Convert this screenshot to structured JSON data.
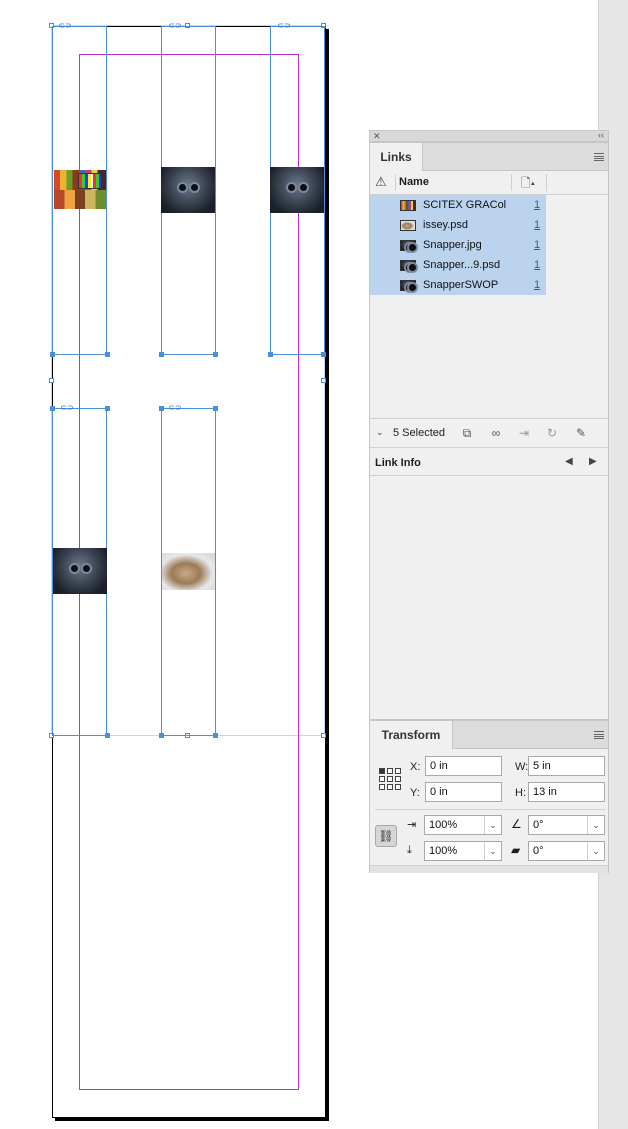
{
  "links_panel": {
    "tab_label": "Links",
    "column_name": "Name",
    "items": [
      {
        "name": "SCITEX GRACol",
        "page": "1",
        "thumb": "color-chart"
      },
      {
        "name": "issey.psd",
        "page": "1",
        "thumb": "cat"
      },
      {
        "name": "Snapper.jpg",
        "page": "1",
        "thumb": "snapper"
      },
      {
        "name": "Snapper...9.psd",
        "page": "1",
        "thumb": "snapper"
      },
      {
        "name": "SnapperSWOP",
        "page": "1",
        "thumb": "snapper"
      }
    ],
    "selected_count": "5 Selected",
    "link_info_label": "Link Info"
  },
  "transform_panel": {
    "tab_label": "Transform",
    "x_label": "X:",
    "x_value": "0 in",
    "y_label": "Y:",
    "y_value": "0 in",
    "w_label": "W:",
    "w_value": "5 in",
    "h_label": "H:",
    "h_value": "13 in",
    "scale_x": "100%",
    "scale_y": "100%",
    "rotation": "0°",
    "shear": "0°"
  },
  "icons": {
    "close": "close-icon",
    "collapse": "double-chevron-icon",
    "warning": "warning-icon",
    "sort_page": "page-sort-icon",
    "menu": "panel-menu-icon"
  },
  "colors": {
    "frame_stroke": "#4a90d9",
    "margin_guide": "#c02fd0",
    "selection": "#bcd3ee",
    "link_text": "#1a5fc4"
  }
}
